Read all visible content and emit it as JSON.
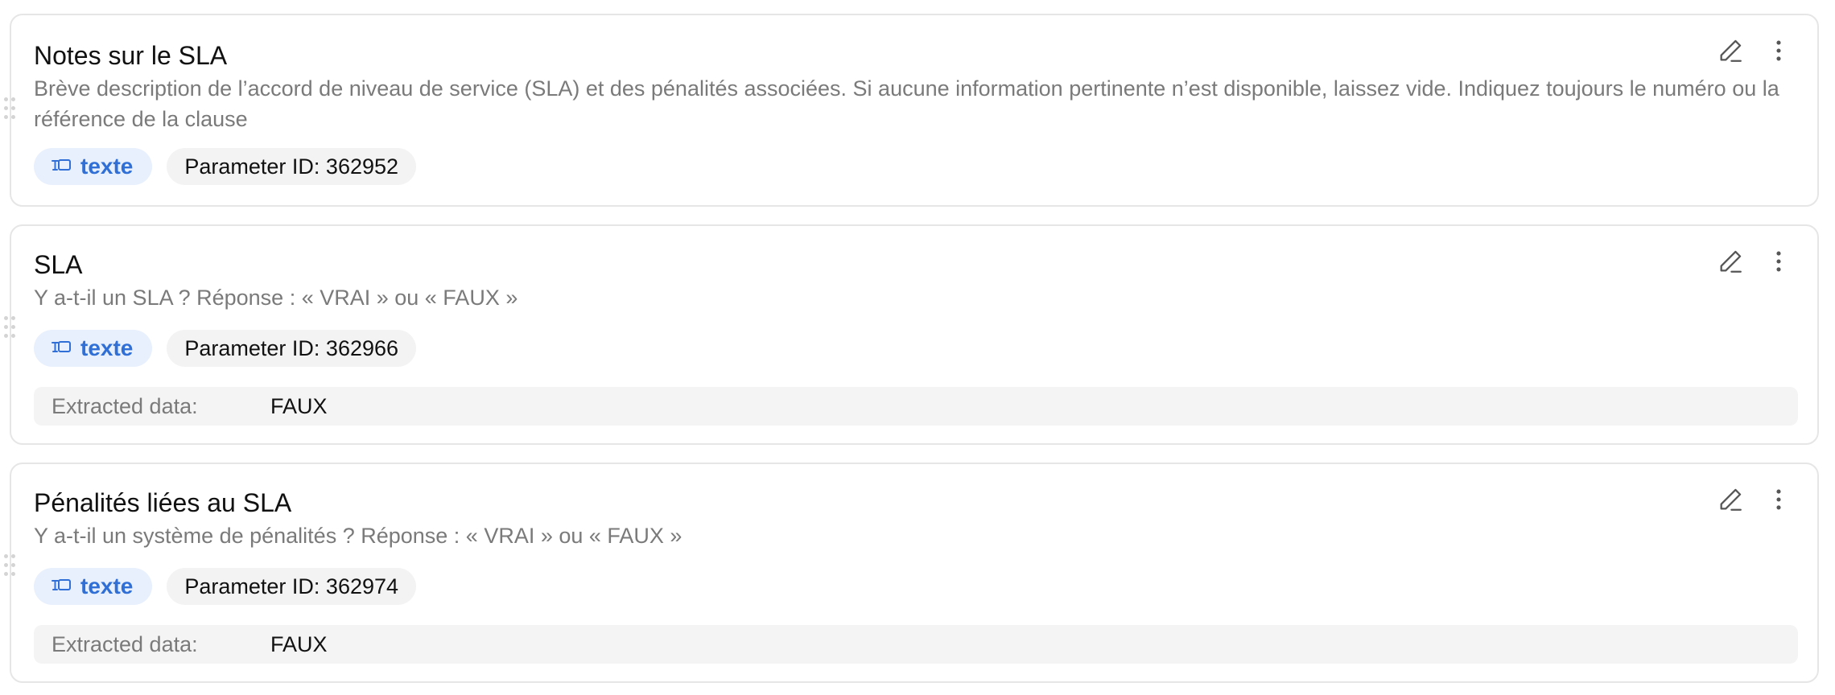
{
  "parameters": [
    {
      "title": "Notes sur le SLA",
      "description": "Brève description de l’accord de niveau de service (SLA) et des pénalités associées. Si aucune information pertinente n’est disponible, laissez vide. Indiquez toujours le numéro ou la référence de la clause",
      "type_label": "texte",
      "param_id": "Parameter ID: 362952",
      "type_icon": "text-type-icon"
    },
    {
      "title": "SLA",
      "description": "Y a-t-il un SLA ? Réponse : « VRAI » ou « FAUX »",
      "type_label": "texte",
      "param_id": "Parameter ID: 362966",
      "type_icon": "text-type-icon",
      "extracted_label": "Extracted data:",
      "extracted_value": "FAUX"
    },
    {
      "title": "Pénalités liées au SLA",
      "description": "Y a-t-il un système de pénalités ? Réponse : « VRAI » ou « FAUX »",
      "type_label": "texte",
      "param_id": "Parameter ID: 362974",
      "type_icon": "text-type-icon",
      "extracted_label": "Extracted data:",
      "extracted_value": "FAUX"
    }
  ],
  "icons": {
    "edit": "pencil-icon",
    "menu": "more-vertical-icon",
    "drag": "drag-handle-icon"
  },
  "colors": {
    "tag_type_bg": "#e8f0fd",
    "tag_type_text": "#2f6fd6",
    "tag_param_bg": "#f3f3f3",
    "extracted_bg": "#f4f4f4",
    "muted_text": "#7a7a7a"
  }
}
